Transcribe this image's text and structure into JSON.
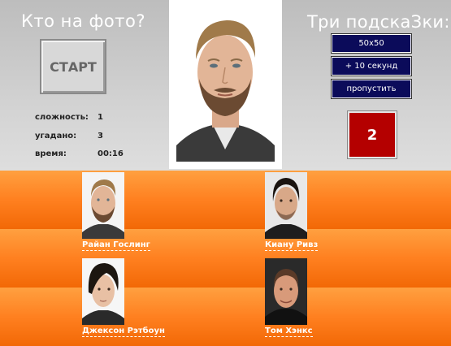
{
  "header": {
    "title_left": "Кто на фото?",
    "title_right": "Три подскаЗки:"
  },
  "start_button": {
    "label": "СТАРТ"
  },
  "stats": [
    {
      "label": "сложность:",
      "value": "1"
    },
    {
      "label": "угадано:",
      "value": "3"
    },
    {
      "label": "время:",
      "value": "00:16"
    }
  ],
  "hints": [
    {
      "label": "50x50"
    },
    {
      "label": "+ 10 секунд"
    },
    {
      "label": "пропустить"
    }
  ],
  "score": "2",
  "answers": [
    {
      "name": "Райан Гослинг"
    },
    {
      "name": "Киану Ривз"
    },
    {
      "name": "Джексон Рэтбоун"
    },
    {
      "name": "Том Хэнкс"
    }
  ],
  "colors": {
    "hint_button_bg": "#0b0b5a",
    "score_bg": "#b40000",
    "answer_area_orange": "#ff8020"
  }
}
